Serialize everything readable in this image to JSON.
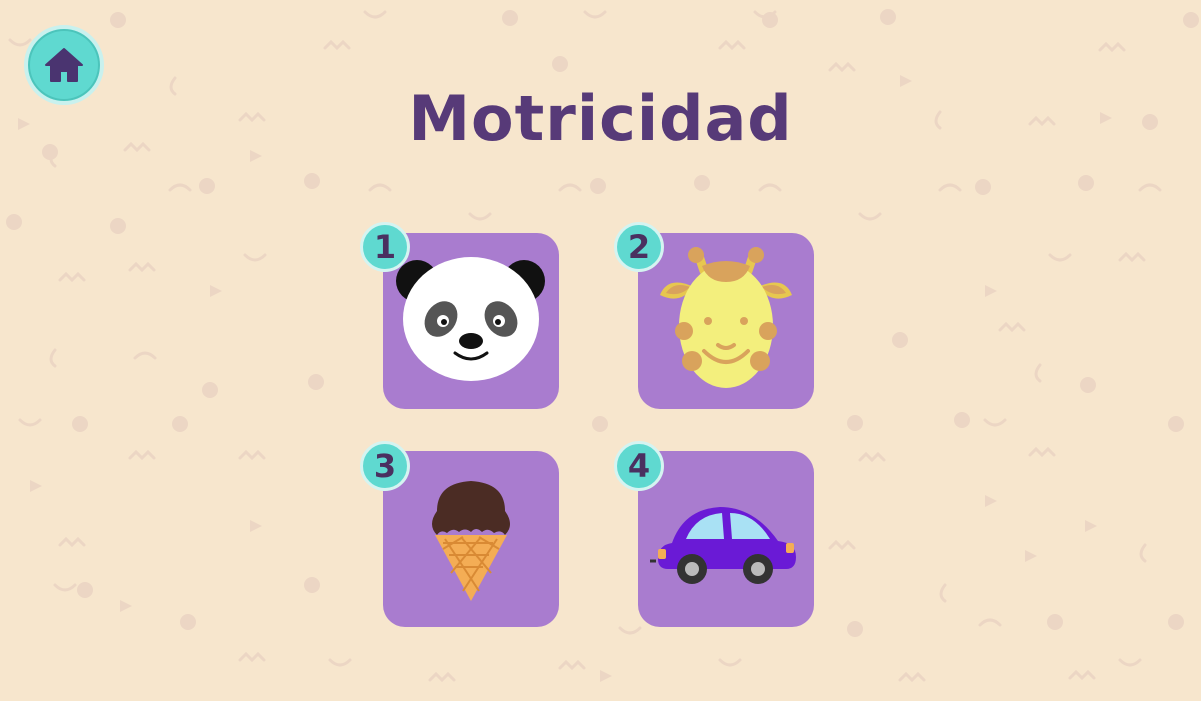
{
  "app": {
    "title": "Motricidad"
  },
  "nav": {
    "home_icon": "home-icon"
  },
  "activities": [
    {
      "number": "1",
      "icon": "panda-icon"
    },
    {
      "number": "2",
      "icon": "giraffe-icon"
    },
    {
      "number": "3",
      "icon": "ice-cream-icon"
    },
    {
      "number": "4",
      "icon": "car-icon"
    }
  ],
  "colors": {
    "background": "#f7e6cd",
    "title": "#573a78",
    "tile": "#a97ccf",
    "accent": "#5fd9d0"
  }
}
